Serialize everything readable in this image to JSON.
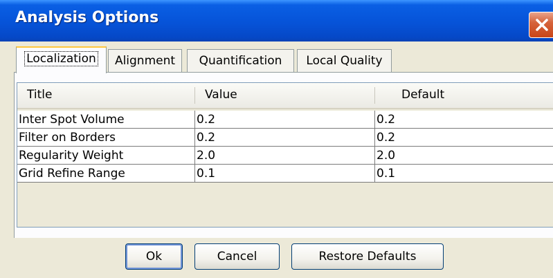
{
  "window": {
    "title": "Analysis Options"
  },
  "tabs": [
    {
      "label": "Localization",
      "active": true
    },
    {
      "label": "Alignment",
      "active": false
    },
    {
      "label": "Quantification",
      "active": false
    },
    {
      "label": "Local Quality",
      "active": false
    }
  ],
  "table": {
    "columns": [
      "Title",
      "Value",
      "Default"
    ],
    "rows": [
      [
        "Inter Spot Volume",
        "0.2",
        "0.2"
      ],
      [
        "Filter on Borders",
        "0.2",
        "0.2"
      ],
      [
        "Regularity Weight",
        "2.0",
        "2.0"
      ],
      [
        "Grid Refine Range",
        "0.1",
        "0.1"
      ]
    ]
  },
  "buttons": {
    "ok": "Ok",
    "cancel": "Cancel",
    "restore": "Restore Defaults"
  },
  "icons": {
    "close": "close-icon"
  },
  "colors": {
    "titlebar": "#0653d8",
    "close_button": "#d6643c",
    "active_tab_accent": "#ffc73c",
    "window_bg": "#ece9d8"
  }
}
